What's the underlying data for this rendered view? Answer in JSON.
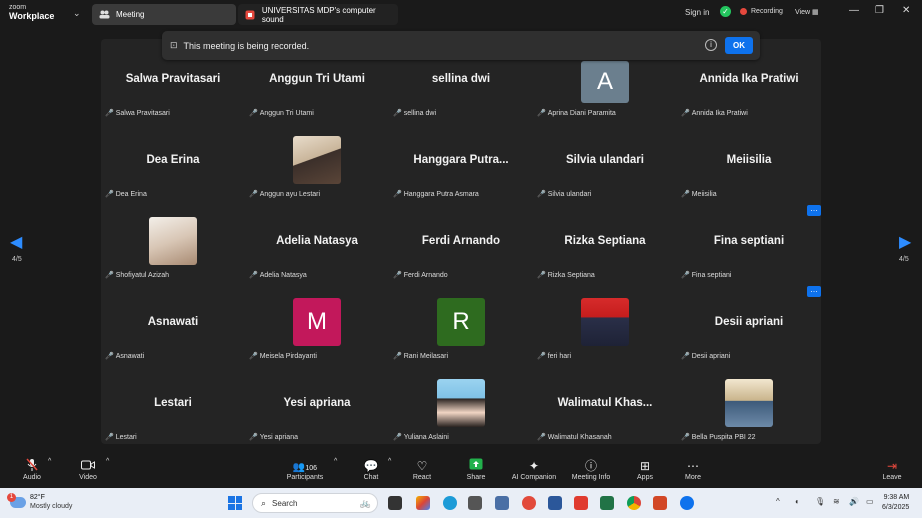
{
  "app": {
    "logo_line1": "zoom",
    "logo_line2": "Workplace",
    "tabs": [
      {
        "label": "Meeting",
        "icon": "people-icon"
      },
      {
        "label": "UNIVERSITAS MDP's computer sound",
        "icon": "share-icon"
      }
    ],
    "signin": "Sign in",
    "recording": "Recording",
    "view": "View"
  },
  "banner": {
    "message": "This meeting is being recorded.",
    "ok_label": "OK"
  },
  "nav": {
    "page_left": "4/5",
    "page_right": "4/5"
  },
  "colors": {
    "accent": "#0e72ed",
    "avatar_A": "#6b7f8e",
    "avatar_M": "#c2185b",
    "avatar_R": "#2e6b1f",
    "mute_red": "#e5483d"
  },
  "participants": [
    {
      "display": "Salwa Pravitasari",
      "label": "Salwa Pravitasari",
      "kind": "name"
    },
    {
      "display": "Anggun Tri Utami",
      "label": "Anggun Tri Utami",
      "kind": "name"
    },
    {
      "display": "sellina dwi",
      "label": "sellina dwi",
      "kind": "name"
    },
    {
      "display": "A",
      "label": "Aprina Diani Paramita",
      "kind": "letter"
    },
    {
      "display": "Annida Ika Pratiwi",
      "label": "Annida Ika Pratiwi",
      "kind": "name"
    },
    {
      "display": "Dea Erina",
      "label": "Dea Erina",
      "kind": "name"
    },
    {
      "display": "",
      "label": "Anggun ayu Lestari",
      "kind": "photo"
    },
    {
      "display": "Hanggara  Putra...",
      "label": "Hanggara Putra Asmara",
      "kind": "name"
    },
    {
      "display": "Silvia ulandari",
      "label": "Silvia ulandari",
      "kind": "name"
    },
    {
      "display": "Meiisilia",
      "label": "Meiisilia",
      "kind": "name"
    },
    {
      "display": "",
      "label": "Shofiyatul Azizah",
      "kind": "photo"
    },
    {
      "display": "Adelia Natasya",
      "label": "Adelia Natasya",
      "kind": "name"
    },
    {
      "display": "Ferdi Arnando",
      "label": "Ferdi Arnando",
      "kind": "name"
    },
    {
      "display": "Rizka Septiana",
      "label": "Rizka Septiana",
      "kind": "name"
    },
    {
      "display": "Fina septiani",
      "label": "Fina septiani",
      "kind": "name"
    },
    {
      "display": "Asnawati",
      "label": "Asnawati",
      "kind": "name"
    },
    {
      "display": "M",
      "label": "Meisela Pirdayanti",
      "kind": "letter"
    },
    {
      "display": "R",
      "label": "Rani Meilasari",
      "kind": "letter"
    },
    {
      "display": "",
      "label": "feri hari",
      "kind": "photo"
    },
    {
      "display": "Desii apriani",
      "label": "Desii apriani",
      "kind": "name"
    },
    {
      "display": "Lestari",
      "label": "Lestari",
      "kind": "name"
    },
    {
      "display": "Yesi apriana",
      "label": "Yesi apriana",
      "kind": "name"
    },
    {
      "display": "",
      "label": "Yuliana Aslaini",
      "kind": "photo"
    },
    {
      "display": "Walimatul  Khas...",
      "label": "Walimatul Khasanah",
      "kind": "name"
    },
    {
      "display": "",
      "label": "Bella Puspita  PBI 22",
      "kind": "photo"
    }
  ],
  "toolbar": {
    "audio": "Audio",
    "video": "Video",
    "participants": "Participants",
    "participants_count": "106",
    "chat": "Chat",
    "react": "React",
    "share": "Share",
    "ai": "AI Companion",
    "meeting_info": "Meeting Info",
    "apps": "Apps",
    "more": "More",
    "leave": "Leave"
  },
  "taskbar": {
    "temp": "82°F",
    "weather": "Mostly cloudy",
    "weather_badge": "1",
    "search": "Search",
    "time": "9:38 AM",
    "date": "6/3/2025"
  }
}
